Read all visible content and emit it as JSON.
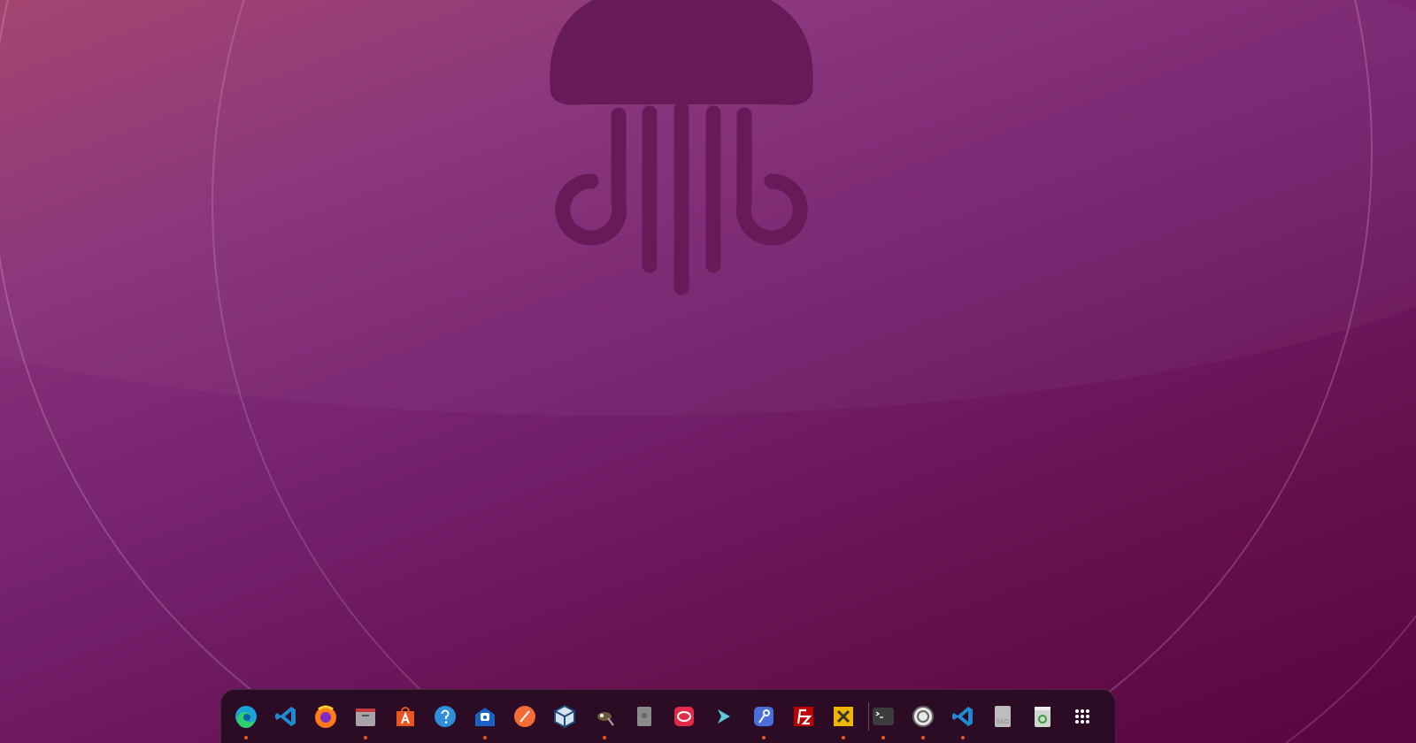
{
  "wallpaper": {
    "colors": [
      "#a13f6c",
      "#73206c",
      "#5a0440"
    ],
    "logo": "jellyfish-icon",
    "logo_color": "#661a57"
  },
  "dock": {
    "accent": "#e95420",
    "apps": [
      {
        "icon": "edge-icon",
        "running": true
      },
      {
        "icon": "vscode-icon",
        "running": false
      },
      {
        "icon": "firefox-icon",
        "running": false
      },
      {
        "icon": "files-icon",
        "running": true
      },
      {
        "icon": "app-center-icon",
        "running": false
      },
      {
        "icon": "help-icon",
        "running": false
      },
      {
        "icon": "mailspring-icon",
        "running": true
      },
      {
        "icon": "postman-icon",
        "running": false
      },
      {
        "icon": "virtualbox-icon",
        "running": false
      },
      {
        "icon": "gimp-icon",
        "running": true
      },
      {
        "icon": "disk-utility-icon",
        "running": false
      },
      {
        "icon": "rocketchat-icon",
        "running": false
      },
      {
        "icon": "remmina-icon",
        "running": false
      },
      {
        "icon": "dev-tool-icon",
        "running": true
      },
      {
        "icon": "filezilla-icon",
        "running": false
      },
      {
        "icon": "vmware-icon",
        "running": true
      }
    ],
    "pinned_right": [
      {
        "icon": "terminal-icon",
        "running": true
      },
      {
        "icon": "settings-icon",
        "running": true
      },
      {
        "icon": "vscode-icon",
        "running": true
      },
      {
        "icon": "ssd-drive-icon",
        "running": false,
        "label": "SSD"
      },
      {
        "icon": "trash-icon",
        "running": false
      },
      {
        "icon": "show-apps-icon",
        "running": false
      }
    ]
  }
}
